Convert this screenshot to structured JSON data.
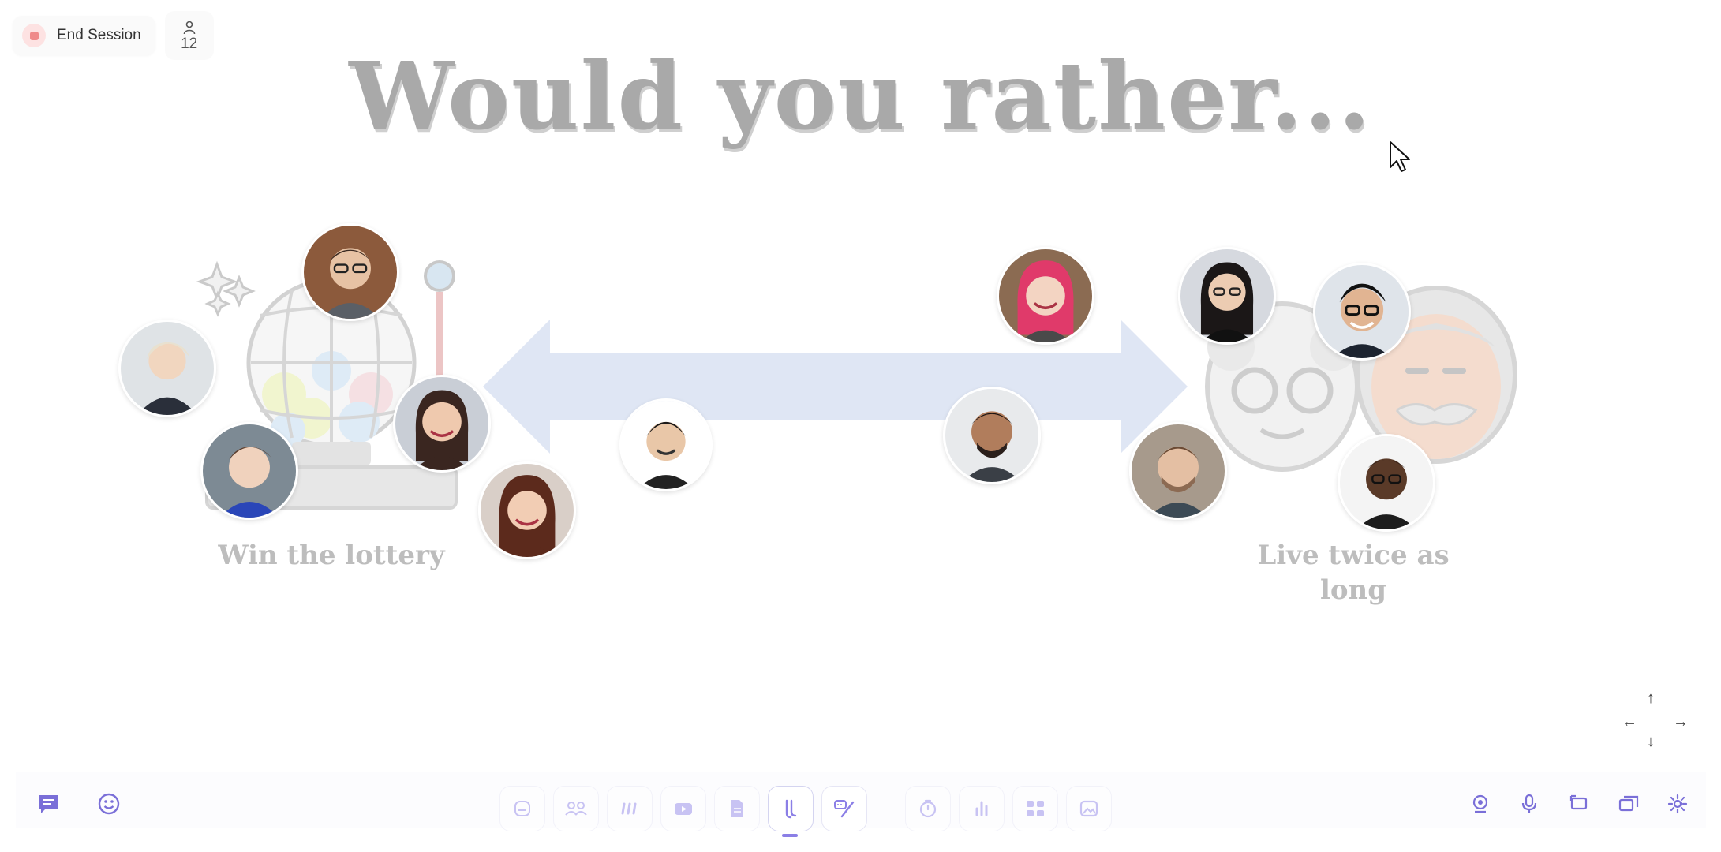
{
  "session": {
    "end_label": "End Session",
    "participant_count": "12"
  },
  "slide": {
    "title": "Would you rather...",
    "option_left": "Win the lottery",
    "option_right_line1": "Live twice as",
    "option_right_line2": "long"
  },
  "colors": {
    "accent": "#8b7fe6",
    "title_gray": "#a9a9a9",
    "arrow_blue": "#dfe6f4",
    "end_dot": "#ef8a8a"
  },
  "icons": {
    "chat": "chat-icon",
    "emoji": "emoji-icon",
    "webcam": "webcam-icon",
    "mic": "mic-icon",
    "share": "share-screen-icon",
    "windows": "windows-icon",
    "settings": "gear-icon"
  },
  "toolbar_tools": [
    "whiteboard-tool",
    "groups-tool",
    "quotes-tool",
    "video-tool",
    "document-tool",
    "spectrum-tool",
    "quiz-tool",
    "timer-tool",
    "poll-tool",
    "teams-tool",
    "image-tool"
  ]
}
